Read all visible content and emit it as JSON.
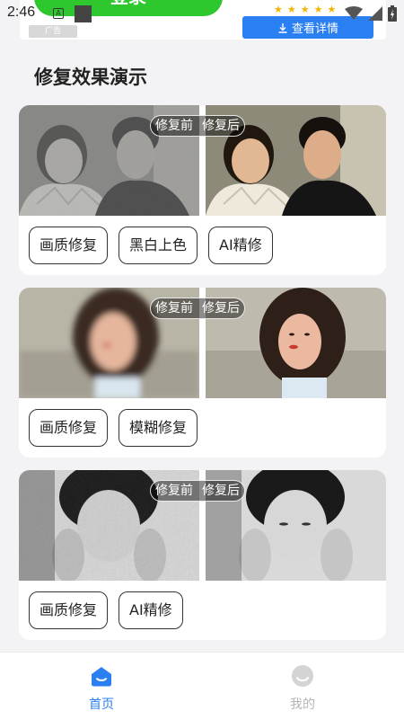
{
  "status": {
    "time": "2:46",
    "stars_count": 5
  },
  "ad": {
    "green_button_label": "登录",
    "grey_label": "广告",
    "detail_label": "查看详情"
  },
  "section_title": "修复效果演示",
  "compare_badge": {
    "before": "修复前",
    "after": "修复后"
  },
  "cards": [
    {
      "tags": [
        "画质修复",
        "黑白上色",
        "AI精修"
      ]
    },
    {
      "tags": [
        "画质修复",
        "模糊修复"
      ]
    },
    {
      "tags": [
        "画质修复",
        "AI精修"
      ]
    }
  ],
  "nav": {
    "home_label": "首页",
    "mine_label": "我的",
    "active_color": "#2a7ff2",
    "inactive_color": "#b5b5b5"
  }
}
